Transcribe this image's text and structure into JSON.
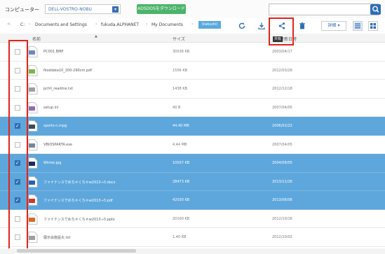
{
  "toolbar": {
    "computer_label": "コンピューター",
    "computer_value": "DELL-VOSTRO-NOBU",
    "green_button_label": "ADSDOSをダウンロード"
  },
  "breadcrumb": [
    {
      "label": "C:"
    },
    {
      "label": "Documents and Settings"
    },
    {
      "label": "fukuda.ALPHANET"
    },
    {
      "label": "My Documents"
    },
    {
      "label": "(kakushi)",
      "active": true
    }
  ],
  "actions": {
    "details_label": "詳細",
    "share_tooltip": "共有"
  },
  "columns": {
    "name": "名前",
    "size": "サイズ",
    "date": "更新日時"
  },
  "files": [
    {
      "name": "PC001.BMP",
      "size": "30036 KB",
      "date": "2003/04/17",
      "selected": false,
      "icon": "image-file-icon",
      "icon_color": "#6a89c7"
    },
    {
      "name": "fkoddata10_200-290cm.pdf",
      "size": "1556 KB",
      "date": "2012/03/26",
      "selected": false,
      "icon": "pdf-file-icon",
      "icon_color": "#7ab648"
    },
    {
      "name": "pchll_readme.txt",
      "size": "1438 KB",
      "date": "2012/12/18",
      "selected": false,
      "icon": "text-file-icon",
      "icon_color": "#9aa0a6"
    },
    {
      "name": "setup.ini",
      "size": "40 B",
      "date": "2007/04/05",
      "selected": false,
      "icon": "settings-file-icon",
      "icon_color": "#8e6bb8"
    },
    {
      "name": "sports-n.mpg",
      "size": "44.40 MB",
      "date": "2006/02/22",
      "selected": true,
      "icon": "video-file-icon",
      "icon_color": "#3d4a5c"
    },
    {
      "name": "VBIOSPARTA.exe",
      "size": "4.44 MB",
      "date": "2007/04/05",
      "selected": false,
      "icon": "exe-file-icon",
      "icon_color": "#7a8696"
    },
    {
      "name": "Winter.jpg",
      "size": "10507 KB",
      "date": "2004/08/05",
      "selected": true,
      "icon": "image-file-icon",
      "icon_color": "#1f2a5a"
    },
    {
      "name": "ファイナンスでめちゃくちゃw2013→3.docx",
      "size": "28473 KB",
      "date": "2013/11/26",
      "selected": true,
      "icon": "word-file-icon",
      "icon_color": "#2b5fb0"
    },
    {
      "name": "ファイナンスでめちゃくちゃw2013→3.pdf",
      "size": "42030 KB",
      "date": "2013/06/06",
      "selected": true,
      "icon": "pdf-file-icon",
      "icon_color": "#d3342b"
    },
    {
      "name": "ファイナンスでめちゃくちゃw2013→3.pptx",
      "size": "20100 KB",
      "date": "2012/10/16",
      "selected": false,
      "icon": "ppt-file-icon",
      "icon_color": "#d8692b"
    },
    {
      "name": "展示会施設大.txt",
      "size": "1.40 KB",
      "date": "2012/10/02",
      "selected": false,
      "icon": "text-file-icon",
      "icon_color": "#9aa0a6"
    }
  ],
  "colors": {
    "accent": "#2f6db5",
    "selection": "#5ea7dc",
    "green": "#4bb46a",
    "highlight": "#e2231a"
  }
}
